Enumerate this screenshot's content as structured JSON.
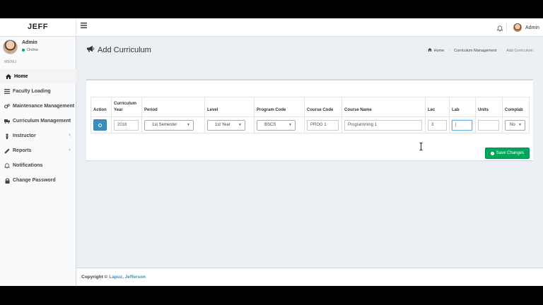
{
  "brand": {
    "logo_text": "JEFF"
  },
  "header": {
    "toggle_icon": "hamburger-icon",
    "user_label": "Admin"
  },
  "sidebar": {
    "user": {
      "name": "Admin",
      "status": "Online",
      "status_color": "#00a65a"
    },
    "menu_header": "MENU",
    "items": [
      {
        "label": "Home",
        "icon": "home-icon",
        "active": true
      },
      {
        "label": "Faculty Loading",
        "icon": "list-icon"
      },
      {
        "label": "Maintenance Management",
        "icon": "gears-icon"
      },
      {
        "label": "Curriculum Management",
        "icon": "truck-icon"
      },
      {
        "label": "Instructor",
        "icon": "user-icon",
        "caret": "‹"
      },
      {
        "label": "Reports",
        "icon": "pencil-icon",
        "caret": "‹"
      },
      {
        "label": "Notifications",
        "icon": "bell-icon"
      },
      {
        "label": "Change Password",
        "icon": "lock-icon"
      }
    ]
  },
  "page": {
    "title": "Add Curriculum",
    "title_icon": "megaphone-icon",
    "breadcrumb": [
      {
        "label": "Home",
        "icon": "home-icon"
      },
      {
        "label": "Curriculum Management"
      },
      {
        "label": "Add Curriculum"
      }
    ]
  },
  "table": {
    "headers": {
      "action": "Action",
      "curriculum_year_1": "Curriculum",
      "curriculum_year_2": "Year",
      "period": "Period",
      "level": "Level",
      "program_code": "Program Code",
      "course_code": "Course Code",
      "course_name": "Course Name",
      "lec": "Lec",
      "lab": "Lab",
      "units": "Units",
      "complab": "Complab"
    },
    "row": {
      "curriculum_year": "2018",
      "period": "1st Semester",
      "level": "1st Year",
      "program_code": "BSCS",
      "course_code": "PROG 1",
      "course_name": "Programming 1",
      "lec": "3",
      "lab": "|",
      "units": "",
      "complab": "No"
    }
  },
  "actions": {
    "save_label": "Save Changes",
    "save_color": "#00a65a",
    "primary_color": "#3c8dbc"
  },
  "footer": {
    "copyright": "Copyright ©",
    "author": "Lapuz, Jefferson"
  }
}
